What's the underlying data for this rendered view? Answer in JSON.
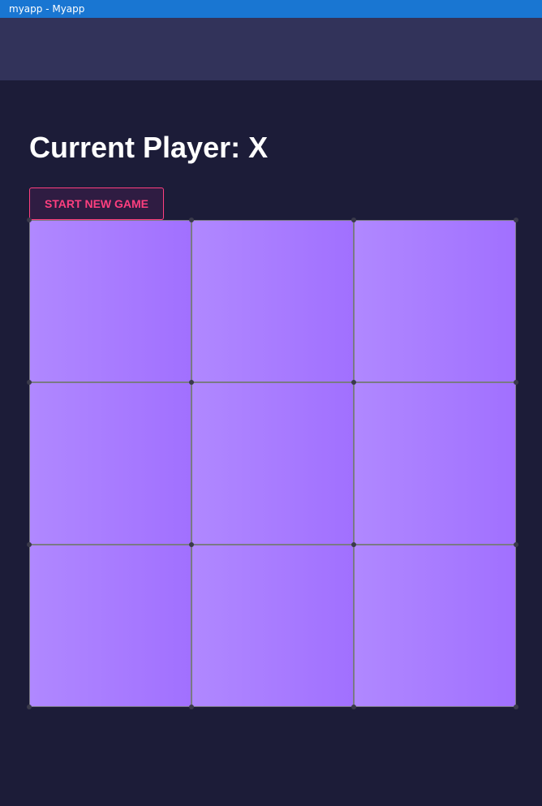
{
  "window": {
    "title": "myapp - Myapp"
  },
  "game": {
    "current_player_label": "Current Player: X",
    "new_game_label": "START NEW GAME",
    "board": [
      "",
      "",
      "",
      "",
      "",
      "",
      "",
      "",
      ""
    ]
  },
  "colors": {
    "titlebar": "#1976d2",
    "appbar": "#32335a",
    "background": "#1c1c38",
    "accent": "#ff3f7f",
    "cell_gradient_start": "#b088ff",
    "cell_gradient_end": "#a170ff"
  }
}
